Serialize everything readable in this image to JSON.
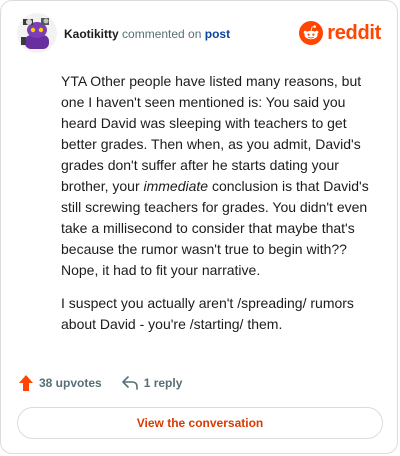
{
  "header": {
    "username": "Kaotikitty",
    "action_text": "commented on",
    "target_text": "post",
    "brand": "reddit",
    "avatar_icon": "snoo-avatar-icon",
    "brand_icon": "reddit-logo-icon"
  },
  "comment": {
    "paragraph1_a": "YTA Other people have listed many reasons, but one I haven't seen mentioned is: You said you heard David was sleeping with teachers to get better grades. Then when, as you admit, David's grades don't suffer after he starts dating your brother, your ",
    "paragraph1_em": "immediate",
    "paragraph1_b": " conclusion is that David's still screwing teachers for grades. You didn't even take a millisecond to consider that maybe that's because the rumor wasn't true to begin with?? Nope, it had to fit your narrative.",
    "paragraph2": "I suspect you actually aren't /spreading/ rumors about David - you're /starting/ them."
  },
  "actions": {
    "upvotes_label": "38 upvotes",
    "reply_label": "1 reply",
    "upvote_icon": "upvote-arrow-icon",
    "reply_icon": "reply-arrow-icon"
  },
  "cta": {
    "label": "View the conversation"
  },
  "colors": {
    "brand": "#ff4500",
    "link": "#0a449b",
    "cta": "#d93a00",
    "muted": "#576f76",
    "text": "#1c1c1c"
  }
}
